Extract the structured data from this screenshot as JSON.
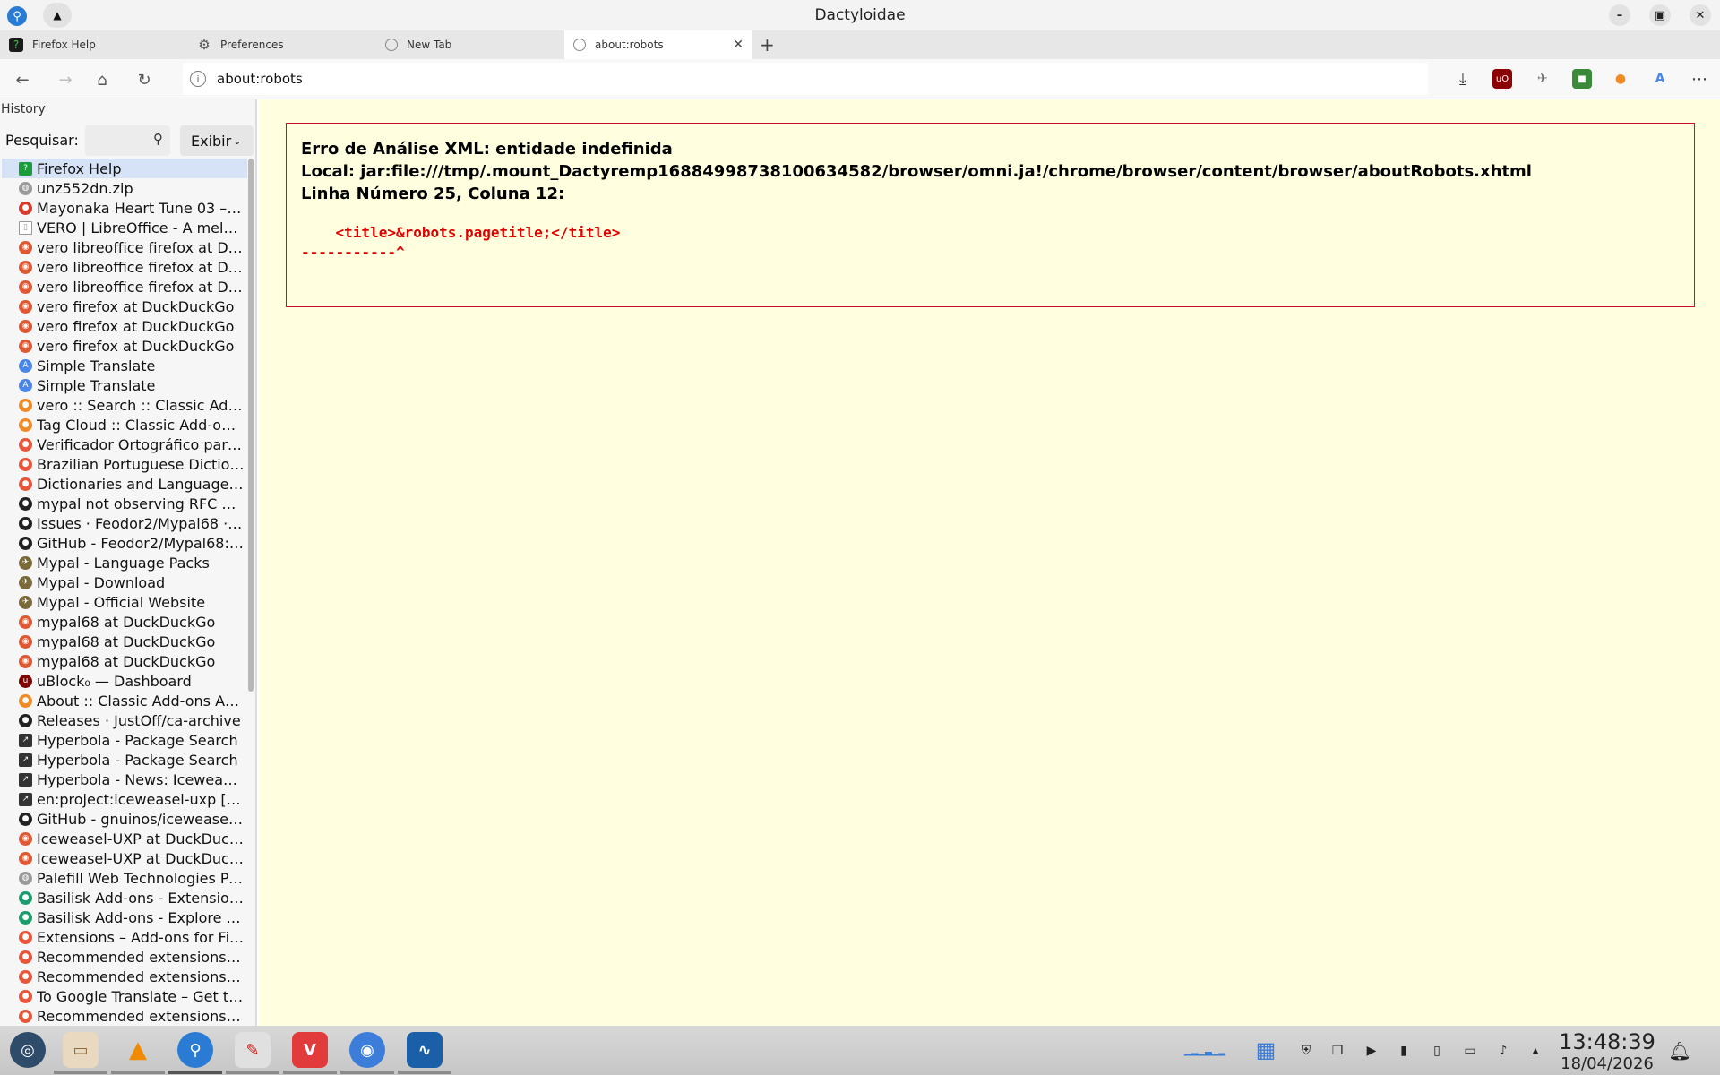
{
  "window": {
    "title": "Dactyloidae"
  },
  "tabs": [
    {
      "label": "Firefox Help",
      "icon": "firefox-help-icon"
    },
    {
      "label": "Preferences",
      "icon": "gear-icon"
    },
    {
      "label": "New Tab",
      "icon": "globe-icon"
    },
    {
      "label": "about:robots",
      "icon": "globe-icon",
      "active": true
    }
  ],
  "url": {
    "value": "about:robots"
  },
  "sidebar": {
    "title": "History",
    "search_label": "Pesquisar:",
    "view_label": "Exibir",
    "items": [
      {
        "label": "Firefox Help",
        "icon": "help",
        "color": "#1b9c3a"
      },
      {
        "label": "unz552dn.zip",
        "icon": "globe",
        "color": "#9a9a9a"
      },
      {
        "label": "Mayonaka Heart Tune 03 – T...",
        "icon": "tomato",
        "color": "#d63b2b"
      },
      {
        "label": "VERO | LibreOffice - A melh...",
        "icon": "page",
        "color": "#ffffff"
      },
      {
        "label": "vero libreoffice firefox at Du...",
        "icon": "ddg",
        "color": "#de5833"
      },
      {
        "label": "vero libreoffice firefox at Du...",
        "icon": "ddg",
        "color": "#de5833"
      },
      {
        "label": "vero libreoffice firefox at Du...",
        "icon": "ddg",
        "color": "#de5833"
      },
      {
        "label": "vero firefox at DuckDuckGo",
        "icon": "ddg",
        "color": "#de5833"
      },
      {
        "label": "vero firefox at DuckDuckGo",
        "icon": "ddg",
        "color": "#de5833"
      },
      {
        "label": "vero firefox at DuckDuckGo",
        "icon": "ddg",
        "color": "#de5833"
      },
      {
        "label": "Simple Translate",
        "icon": "translate",
        "color": "#4a86e8"
      },
      {
        "label": "Simple Translate",
        "icon": "translate",
        "color": "#4a86e8"
      },
      {
        "label": "vero :: Search :: Classic Add-...",
        "icon": "addon",
        "color": "#f08a24"
      },
      {
        "label": "Tag Cloud :: Classic Add-ons ...",
        "icon": "addon",
        "color": "#f08a24"
      },
      {
        "label": "Verificador Ortográfico para...",
        "icon": "firefox",
        "color": "#e8563a"
      },
      {
        "label": "Brazilian Portuguese Diction...",
        "icon": "firefox",
        "color": "#e8563a"
      },
      {
        "label": "Dictionaries and Language ...",
        "icon": "firefox",
        "color": "#e8563a"
      },
      {
        "label": "mypal not observing RFC 89...",
        "icon": "github",
        "color": "#222222"
      },
      {
        "label": "Issues · Feodor2/Mypal68 · ...",
        "icon": "github",
        "color": "#222222"
      },
      {
        "label": "GitHub - Feodor2/Mypal68: ...",
        "icon": "github",
        "color": "#222222"
      },
      {
        "label": "Mypal - Language Packs",
        "icon": "mypal",
        "color": "#7a6a3a"
      },
      {
        "label": "Mypal - Download",
        "icon": "mypal",
        "color": "#7a6a3a"
      },
      {
        "label": "Mypal - Official Website",
        "icon": "mypal",
        "color": "#7a6a3a"
      },
      {
        "label": "mypal68 at DuckDuckGo",
        "icon": "ddg",
        "color": "#de5833"
      },
      {
        "label": "mypal68 at DuckDuckGo",
        "icon": "ddg",
        "color": "#de5833"
      },
      {
        "label": "mypal68 at DuckDuckGo",
        "icon": "ddg",
        "color": "#de5833"
      },
      {
        "label": "uBlock₀ — Dashboard",
        "icon": "ublock",
        "color": "#800000"
      },
      {
        "label": "About :: Classic Add-ons Arc...",
        "icon": "addon",
        "color": "#f08a24"
      },
      {
        "label": "Releases · JustOff/ca-archive",
        "icon": "github",
        "color": "#222222"
      },
      {
        "label": "Hyperbola - Package Search",
        "icon": "hyperbola",
        "color": "#333333"
      },
      {
        "label": "Hyperbola - Package Search",
        "icon": "hyperbola",
        "color": "#333333"
      },
      {
        "label": "Hyperbola - News: Icewease...",
        "icon": "hyperbola",
        "color": "#333333"
      },
      {
        "label": "en:project:iceweasel-uxp [H...",
        "icon": "hyperbola",
        "color": "#333333"
      },
      {
        "label": "GitHub - gnuinos/iceweasel-...",
        "icon": "github",
        "color": "#222222"
      },
      {
        "label": "Iceweasel-UXP at DuckDuck...",
        "icon": "ddg",
        "color": "#de5833"
      },
      {
        "label": "Iceweasel-UXP at DuckDuck...",
        "icon": "ddg",
        "color": "#de5833"
      },
      {
        "label": "Palefill Web Technologies Po...",
        "icon": "globe",
        "color": "#9a9a9a"
      },
      {
        "label": "Basilisk Add-ons - Extensions",
        "icon": "basilisk",
        "color": "#1a9d6b"
      },
      {
        "label": "Basilisk Add-ons - Explore A...",
        "icon": "basilisk",
        "color": "#1a9d6b"
      },
      {
        "label": "Extensions – Add-ons for Fir...",
        "icon": "firefox",
        "color": "#e8563a"
      },
      {
        "label": "Recommended extensions –...",
        "icon": "firefox",
        "color": "#e8563a"
      },
      {
        "label": "Recommended extensions –...",
        "icon": "firefox",
        "color": "#e8563a"
      },
      {
        "label": "To Google Translate – Get th...",
        "icon": "firefox",
        "color": "#e8563a"
      },
      {
        "label": "Recommended extensions –...",
        "icon": "firefox",
        "color": "#e8563a"
      }
    ]
  },
  "error": {
    "line1": "Erro de Análise XML: entidade indefinida",
    "line2": "Local: jar:file:///tmp/.mount_Dactyremp16884998738100634582/browser/omni.ja!/chrome/browser/content/browser/aboutRobots.xhtml",
    "line3": "Linha Número 25, Coluna 12:",
    "code1": "    <title>&robots.pagetitle;</title>",
    "code2": "-----------^"
  },
  "taskbar": {
    "time": "13:48:39",
    "date": "18/04/2026"
  }
}
